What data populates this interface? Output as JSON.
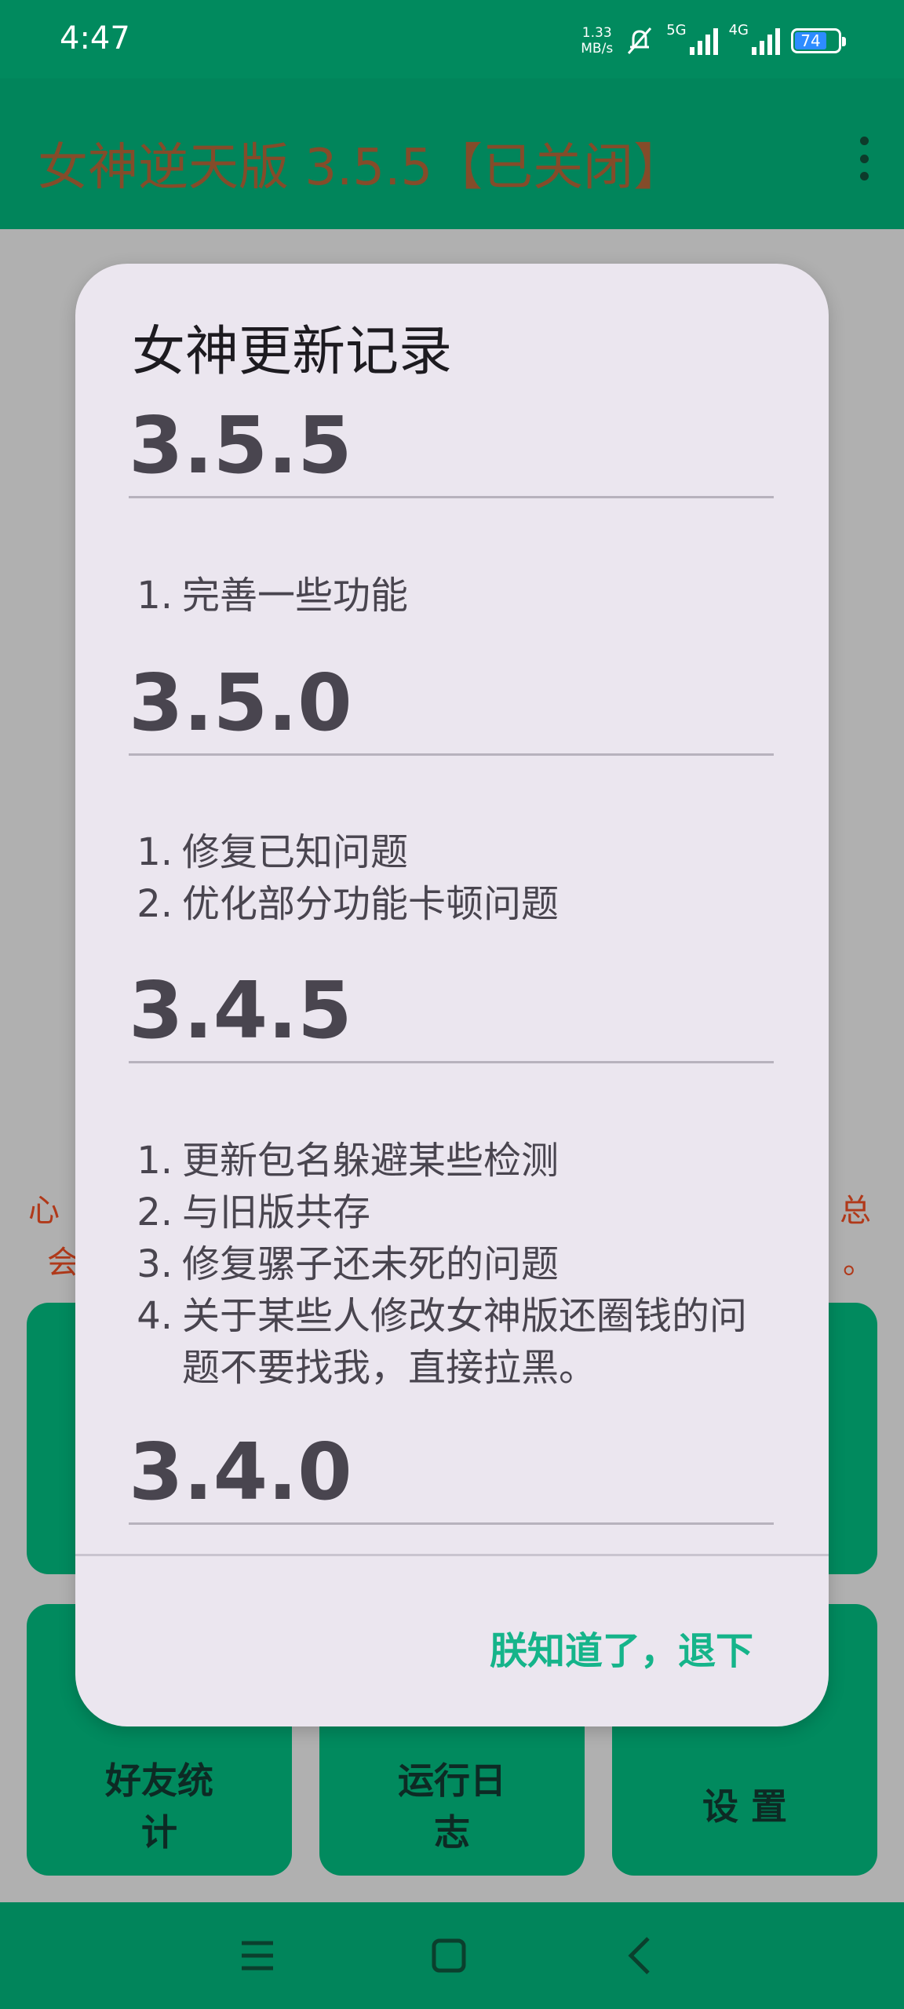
{
  "status_bar": {
    "time": "4:47",
    "net_speed_value": "1.33",
    "net_speed_unit": "MB/s",
    "net_type_1": "5G",
    "net_type_2": "4G",
    "battery": "74",
    "icons": [
      "mute-bell-icon",
      "signal-5g-icon",
      "signal-4g-icon",
      "battery-icon"
    ]
  },
  "app_bar": {
    "title": "女神逆天版 3.5.5【已关闭】",
    "menu_icon": "more-vert-icon"
  },
  "background": {
    "notice_left_line1": "心",
    "notice_left_line2": "会",
    "notice_right_line1": "总",
    "notice_right_line2": "。",
    "tiles": [
      {
        "line1": "好友统",
        "line2": "计"
      },
      {
        "line1": "运行日",
        "line2": "志"
      },
      {
        "line1": "设 置",
        "line2": ""
      }
    ]
  },
  "dialog": {
    "title": "女神更新记录",
    "versions": [
      {
        "version": "3.5.5",
        "notes": [
          {
            "num": "1.",
            "text": "完善一些功能"
          }
        ]
      },
      {
        "version": "3.5.0",
        "notes": [
          {
            "num": "1.",
            "text": "修复已知问题"
          },
          {
            "num": "2.",
            "text": "优化部分功能卡顿问题"
          }
        ]
      },
      {
        "version": "3.4.5",
        "notes": [
          {
            "num": "1.",
            "text": "更新包名躲避某些检测"
          },
          {
            "num": "2.",
            "text": "与旧版共存"
          },
          {
            "num": "3.",
            "text": "修复骡子还未死的问题"
          },
          {
            "num": "4.",
            "text": "关于某些人修改女神版还圈钱的问题不要找我，直接拉黑。"
          }
        ]
      },
      {
        "version": "3.4.0",
        "notes": []
      }
    ],
    "confirm_label": "朕知道了，退下"
  },
  "nav_bar": {
    "icons": [
      "menu-icon",
      "home-icon",
      "back-icon"
    ]
  },
  "colors": {
    "primary": "#018a5e",
    "accent_text": "#15b48a",
    "title_red": "#b0391a",
    "dialog_bg": "#ebe6ef"
  }
}
